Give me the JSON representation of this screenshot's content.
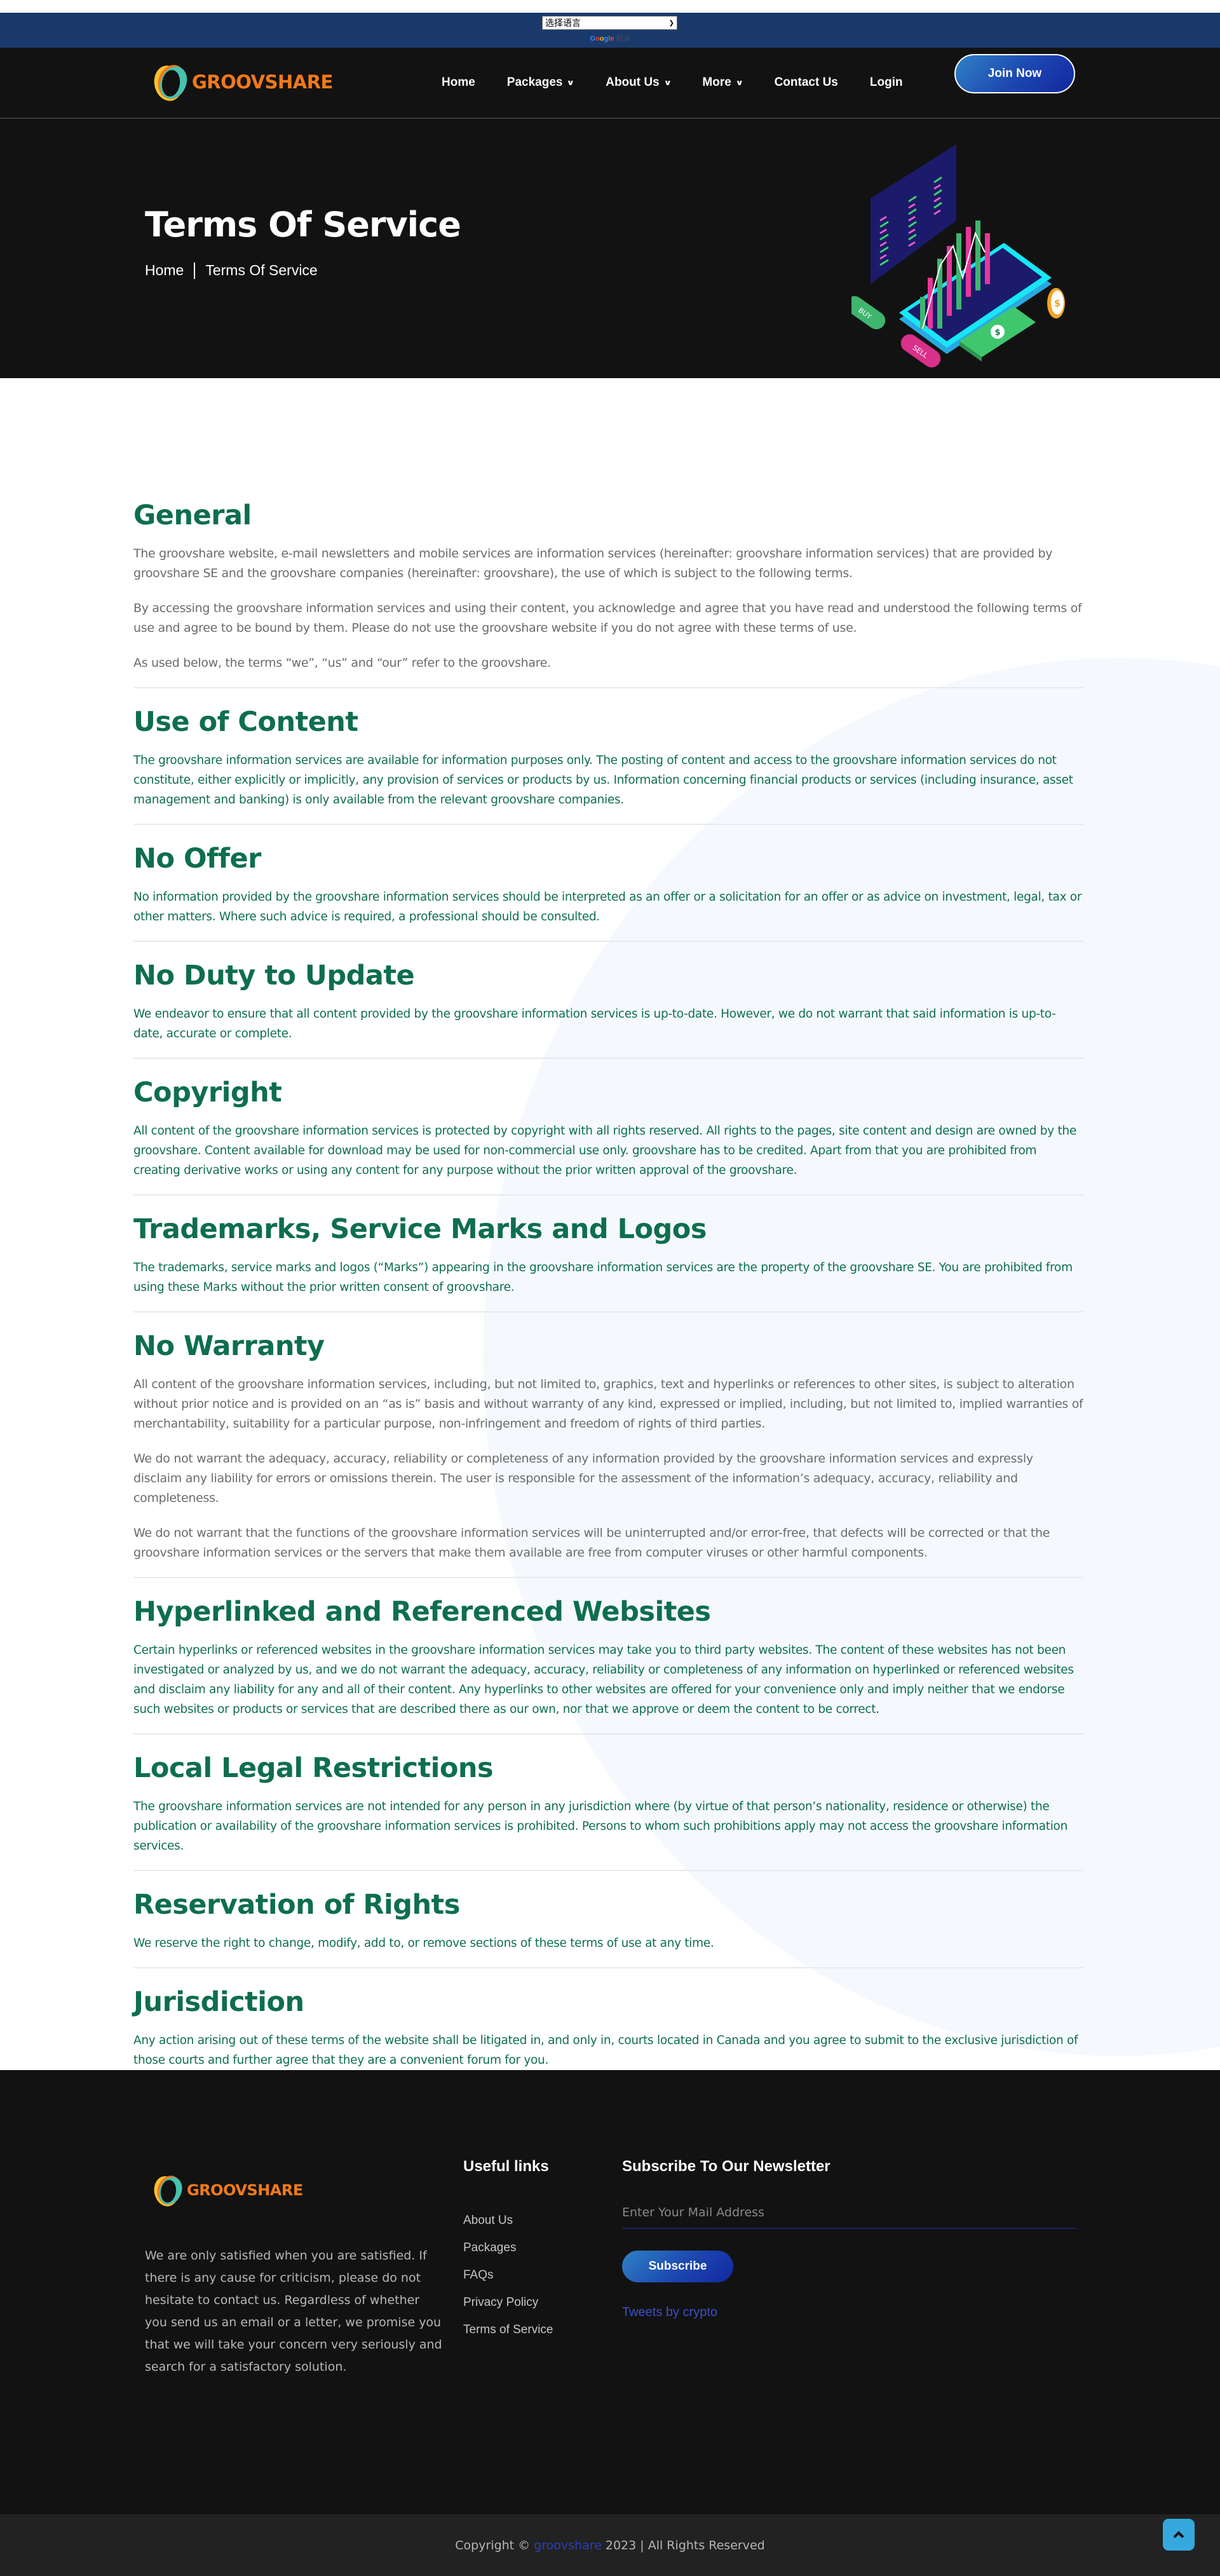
{
  "translate": {
    "select_label": "选择语言",
    "powered_google": "Google",
    "powered_translate": "翻译"
  },
  "brand": {
    "name": "GROOVSHARE",
    "color": "#f07a1a"
  },
  "nav": {
    "items": [
      {
        "label": "Home",
        "dropdown": false
      },
      {
        "label": "Packages",
        "dropdown": true
      },
      {
        "label": "About Us",
        "dropdown": true
      },
      {
        "label": "More",
        "dropdown": true
      },
      {
        "label": "Contact Us",
        "dropdown": false
      },
      {
        "label": "Login",
        "dropdown": false
      }
    ],
    "join_label": "Join Now",
    "dropdown_icon": "chevron-down-icon"
  },
  "hero": {
    "title": "Terms Of Service",
    "breadcrumb": [
      "Home",
      "Terms Of Service"
    ],
    "illustration_labels": {
      "buy": "BUY",
      "sell": "SELL",
      "currency": "$"
    }
  },
  "terms": [
    {
      "title": "General",
      "tone": "gray",
      "paragraphs": [
        "The groovshare website, e-mail newsletters and mobile services are information services (hereinafter: groovshare information services) that are provided by groovshare SE and the groovshare companies (hereinafter: groovshare), the use of which is subject to the following terms.",
        "By accessing the groovshare information services and using their content, you acknowledge and agree that you have read and understood the following terms of use and agree to be bound by them. Please do not use the groovshare website if you do not agree with these terms of use.",
        "As used below, the terms “we”, “us” and “our” refer to the groovshare."
      ]
    },
    {
      "title": "Use of Content",
      "tone": "green",
      "paragraphs": [
        "The groovshare information services are available for information purposes only. The posting of content and access to the groovshare information services do not constitute, either explicitly or implicitly, any provision of services or products by us. Information concerning financial products or services (including insurance, asset management and banking) is only available from the relevant groovshare companies."
      ]
    },
    {
      "title": "No Offer",
      "tone": "green",
      "paragraphs": [
        "No information provided by the groovshare information services should be interpreted as an offer or a solicitation for an offer or as advice on investment, legal, tax or other matters. Where such advice is required, a professional should be consulted."
      ]
    },
    {
      "title": "No Duty to Update",
      "tone": "green",
      "paragraphs": [
        "We endeavor to ensure that all content provided by the groovshare information services is up-to-date. However, we do not warrant that said information is up-to-date, accurate or complete."
      ]
    },
    {
      "title": "Copyright",
      "tone": "green",
      "paragraphs": [
        "All content of the groovshare information services is protected by copyright with all rights reserved. All rights to the pages, site content and design are owned by the groovshare. Content available for download may be used for non-commercial use only. groovshare has to be credited. Apart from that you are prohibited from creating derivative works or using any content for any purpose without the prior written approval of the groovshare."
      ]
    },
    {
      "title": "Trademarks, Service Marks and Logos",
      "tone": "green",
      "paragraphs": [
        "The trademarks, service marks and logos (“Marks”) appearing in the groovshare information services are the property of the groovshare SE. You are prohibited from using these Marks without the prior written consent of groovshare."
      ]
    },
    {
      "title": "No Warranty",
      "tone": "gray",
      "paragraphs": [
        "All content of the groovshare information services, including, but not limited to, graphics, text and hyperlinks or references to other sites, is subject to alteration without prior notice and is provided on an “as is” basis and without warranty of any kind, expressed or implied, including, but not limited to, implied warranties of merchantability, suitability for a particular purpose, non-infringement and freedom of rights of third parties.",
        "We do not warrant the adequacy, accuracy, reliability or completeness of any information provided by the groovshare information services and expressly disclaim any liability for errors or omissions therein. The user is responsible for the assessment of the information’s adequacy, accuracy, reliability and completeness.",
        "We do not warrant that the functions of the groovshare information services will be uninterrupted and/or error-free, that defects will be corrected or that the groovshare information services or the servers that make them available are free from computer viruses or other harmful components."
      ]
    },
    {
      "title": "Hyperlinked and Referenced Websites",
      "tone": "green",
      "paragraphs": [
        "Certain hyperlinks or referenced websites in the groovshare information services may take you to third party websites. The content of these websites has not been investigated or analyzed by us, and we do not warrant the adequacy, accuracy, reliability or completeness of any information on hyperlinked or referenced websites and disclaim any liability for any and all of their content. Any hyperlinks to other websites are offered for your convenience only and imply neither that we endorse such websites or products or services that are described there as our own, nor that we approve or deem the content to be correct."
      ]
    },
    {
      "title": "Local Legal Restrictions",
      "tone": "green",
      "paragraphs": [
        "The groovshare information services are not intended for any person in any jurisdiction where (by virtue of that person’s nationality, residence or otherwise) the publication or availability of the groovshare information services is prohibited. Persons to whom such prohibitions apply may not access the groovshare information services."
      ]
    },
    {
      "title": "Reservation of Rights",
      "tone": "green",
      "paragraphs": [
        "We reserve the right to change, modify, add to, or remove sections of these terms of use at any time."
      ]
    },
    {
      "title": "Jurisdiction",
      "tone": "green",
      "paragraphs": [
        "Any action arising out of these terms of the website shall be litigated in, and only in, courts located in Canada and you agree to submit to the exclusive jurisdiction of those courts and further agree that they are a convenient forum for you."
      ]
    }
  ],
  "footer": {
    "about": "We are only satisfied when you are satisfied. If there is any cause for criticism, please do not hesitate to contact us. Regardless of whether you send us an email or a letter, we promise you that we will take your concern very seriously and search for a satisfactory solution.",
    "useful_links_title": "Useful links",
    "useful_links": [
      "About Us",
      "Packages",
      "FAQs",
      "Privacy Policy",
      "Terms of Service"
    ],
    "newsletter_title": "Subscribe To Our Newsletter",
    "email_placeholder": "Enter Your Mail Address",
    "email_value": "",
    "subscribe_label": "Subscribe",
    "tweets_label": "Tweets by crypto",
    "copyright_prefix": "Copyright © ",
    "copyright_brand": "groovshare",
    "copyright_suffix": " 2023 | All Rights Reserved",
    "scroll_top_icon": "chevron-up-icon"
  },
  "colors": {
    "heading_green": "#0e6e4e",
    "nav_bg": "#121212",
    "translate_bar": "#1a3a6b",
    "accent_blue": "#1c46b0",
    "scroll_top": "#35a8de",
    "logo_orange": "#f07a1a"
  }
}
